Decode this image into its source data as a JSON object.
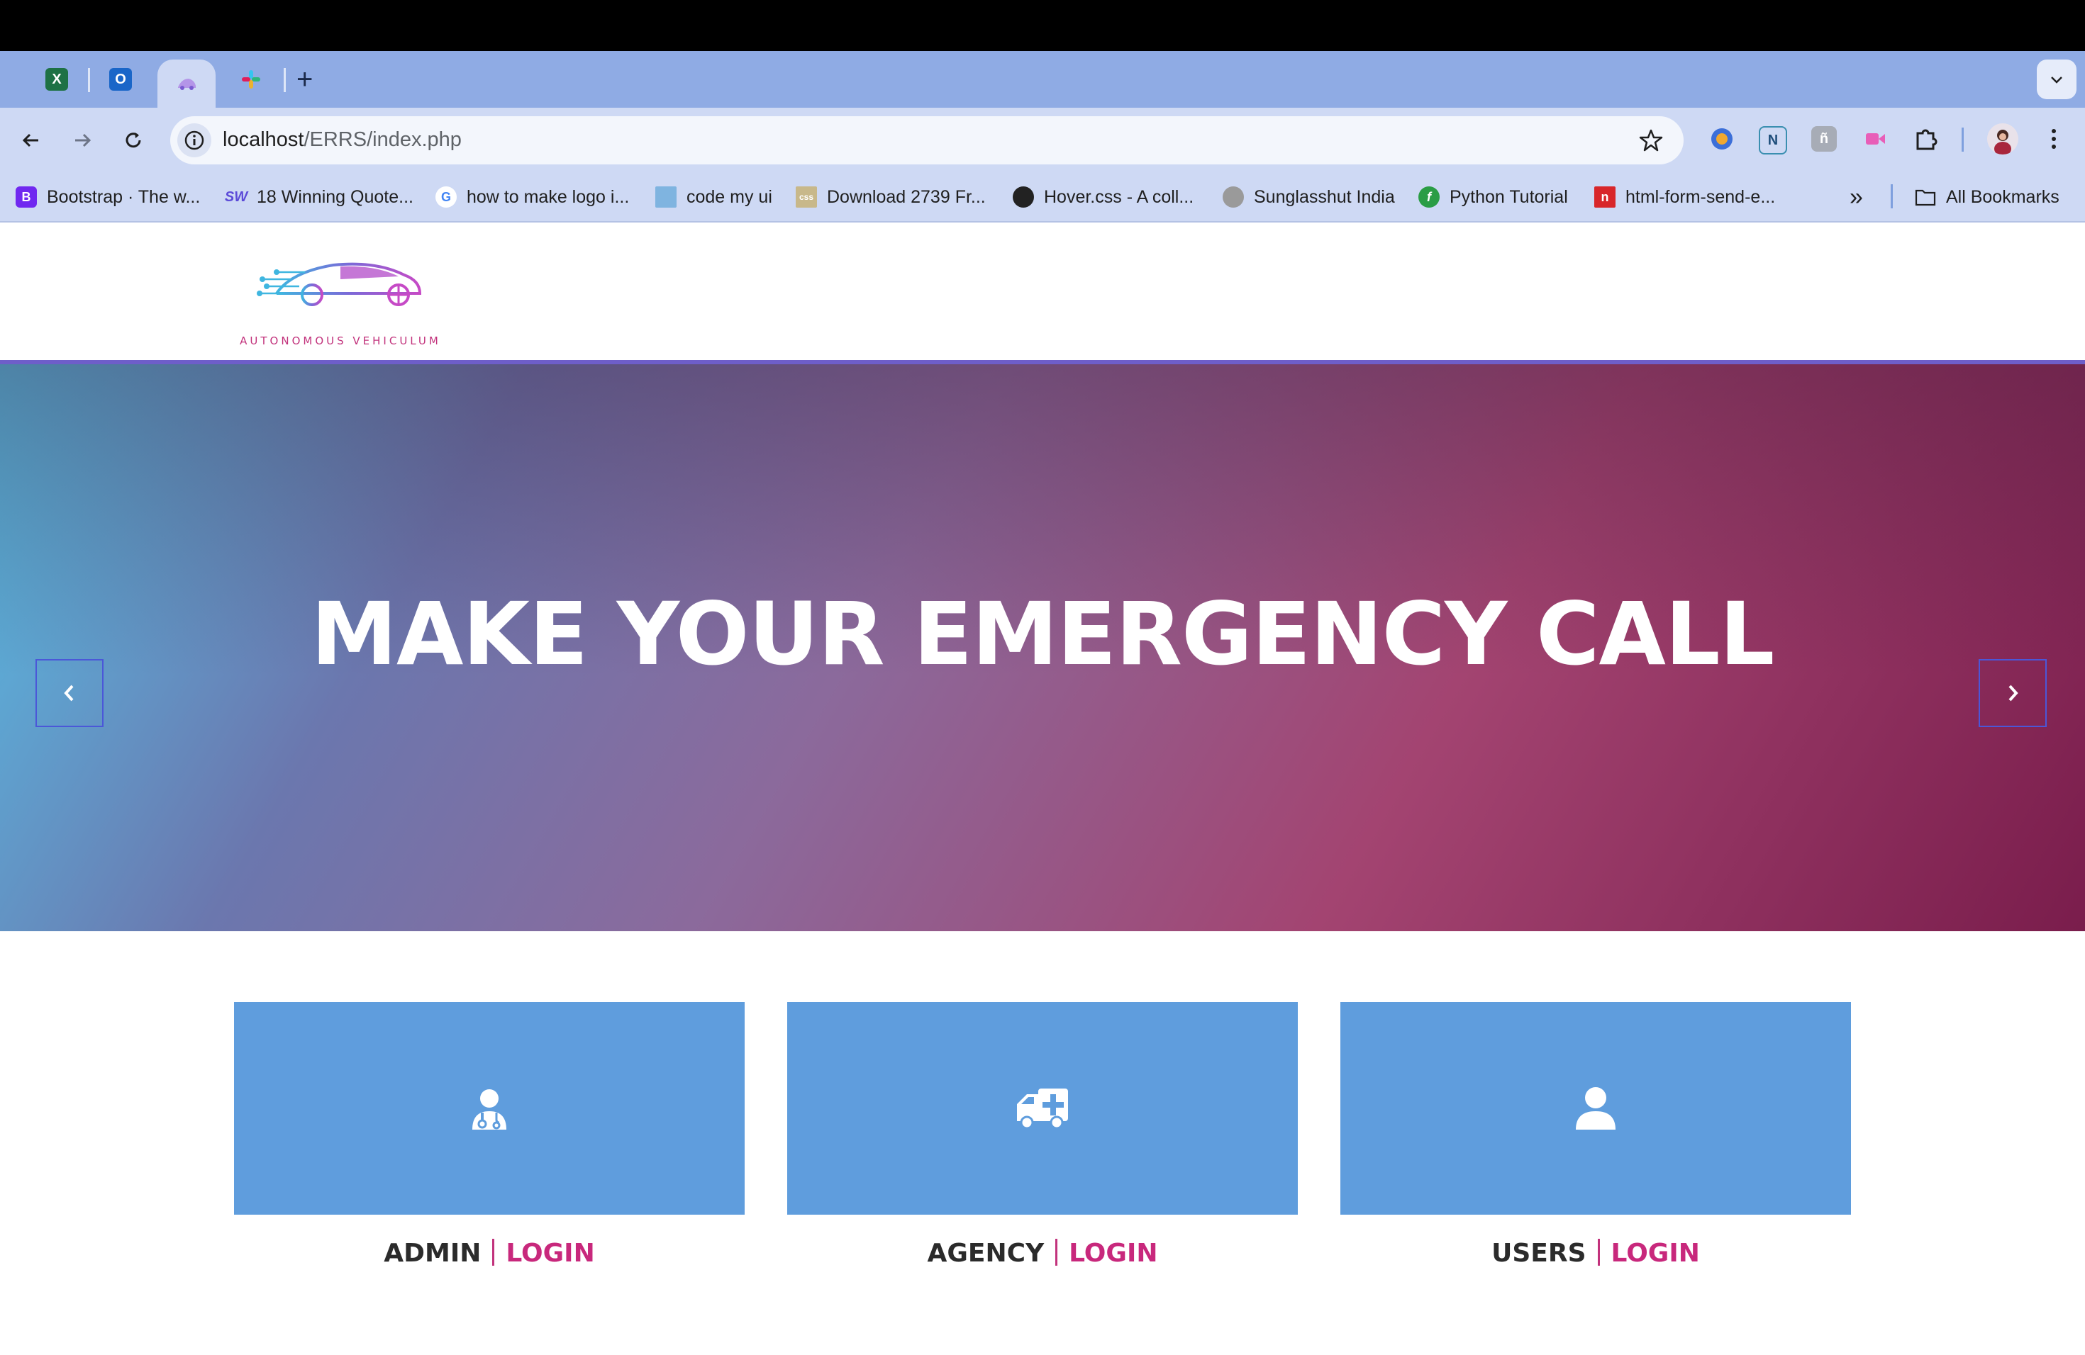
{
  "browser": {
    "tabs": [
      {
        "icon": "excel-icon",
        "letter": "X",
        "color": "#1e7145"
      },
      {
        "icon": "outlook-icon",
        "letter": "O",
        "color": "#1a66c8"
      },
      {
        "icon": "site-logo-icon",
        "letter": "",
        "color": "#b495e8",
        "active": true
      },
      {
        "icon": "slack-icon",
        "letter": "",
        "color": "#e01e5a"
      }
    ],
    "new_tab_label": "+",
    "url_host": "localhost",
    "url_path": "/ERRS/index.php",
    "bookmarks": [
      {
        "label": "Bootstrap · The w...",
        "letter": "B",
        "color": "#7028f0"
      },
      {
        "label": "18 Winning Quote...",
        "letter": "SW",
        "color": "#5c4bd8"
      },
      {
        "label": "how to make logo i...",
        "letter": "G",
        "color": "#ffffff"
      },
      {
        "label": "code my ui",
        "letter": "",
        "color": "#7fb4e0"
      },
      {
        "label": "Download 2739 Fr...",
        "letter": "css",
        "color": "#c8b88a"
      },
      {
        "label": "Hover.css - A coll...",
        "letter": "",
        "color": "#222222"
      },
      {
        "label": "Sunglasshut India",
        "letter": "",
        "color": "#9a9a9a"
      },
      {
        "label": "Python Tutorial",
        "letter": "f",
        "color": "#2a9d45"
      },
      {
        "label": "html-form-send-e...",
        "letter": "n",
        "color": "#d8262a"
      }
    ],
    "more_bookmarks": "»",
    "all_bookmarks_label": "All Bookmarks"
  },
  "site": {
    "logo_text": "AUTONOMOUS VEHICULUM",
    "hero_title": "MAKE YOUR EMERGENCY CALL",
    "cards": [
      {
        "name": "ADMIN",
        "action": "LOGIN",
        "icon": "doctor-icon"
      },
      {
        "name": "AGENCY",
        "action": "LOGIN",
        "icon": "ambulance-icon"
      },
      {
        "name": "USERS",
        "action": "LOGIN",
        "icon": "user-icon"
      }
    ]
  },
  "colors": {
    "card_bg": "#5f9ddd",
    "login_accent": "#c8287c",
    "hero_border": "#6e5ec9"
  }
}
